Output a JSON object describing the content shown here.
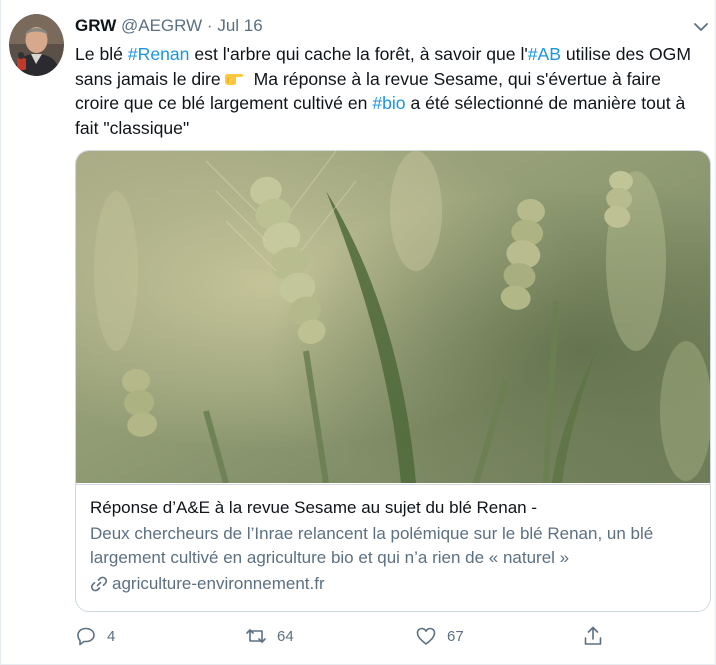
{
  "tweet": {
    "display_name": "GRW",
    "handle": "@AEGRW",
    "separator": "·",
    "date": "Jul 16",
    "text": {
      "p1": "Le blé ",
      "tag1": "#Renan",
      "p2": " est l'arbre qui cache la forêt, à savoir que l'",
      "tag2": "#AB",
      "p3": " utilise des OGM sans jamais le dire",
      "p4": " Ma réponse à la revue Sesame, qui s'évertue à faire croire que ce blé largement cultivé en ",
      "tag3": "#bio",
      "p5": " a été sélectionné de manière tout à fait \"classique\""
    },
    "emoji_icon": "pointing-right-hand-emoji"
  },
  "card": {
    "title": "Réponse d’A&E à la revue Sesame au sujet du blé Renan -",
    "description": "Deux chercheurs de l’Inrae relancent la polémique sur le blé Renan, un blé largement cultivé en agriculture bio et qui n’a rien de « naturel »",
    "domain": "agriculture-environnement.fr",
    "image_subject": "wheat ears in a field"
  },
  "actions": {
    "reply_count": "4",
    "retweet_count": "64",
    "like_count": "67"
  },
  "icons": {
    "reply": "reply-icon",
    "retweet": "retweet-icon",
    "like": "heart-icon",
    "share": "share-icon",
    "more": "chevron-down-icon",
    "link": "link-icon"
  },
  "colors": {
    "hashtag": "#1b95e0",
    "secondary_text": "#5b7083",
    "border": "#cfd9de"
  }
}
